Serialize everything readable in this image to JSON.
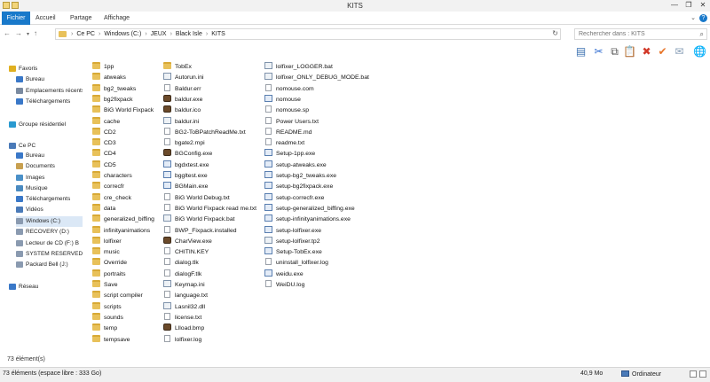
{
  "window": {
    "title": "KITS",
    "minimize": "—",
    "maximize": "❐",
    "close": "✕"
  },
  "ribbon": {
    "tabs": [
      "Fichier",
      "Accueil",
      "Partage",
      "Affichage"
    ],
    "expand": "⌄",
    "help": "?"
  },
  "address": {
    "back": "←",
    "forward": "→",
    "recent": "▾",
    "up": "↑",
    "crumbs": [
      "Ce PC",
      "Windows (C:)",
      "JEUX",
      "Black Isle",
      "KITS"
    ],
    "separator": "›",
    "refresh": "↻"
  },
  "search": {
    "placeholder": "Rechercher dans : KITS",
    "icon": "⌕"
  },
  "toolbar": {
    "icons": [
      "image-list-icon",
      "cut-icon",
      "copy-icon",
      "paste-icon",
      "delete-icon",
      "checkmark-icon",
      "email-icon",
      "web-icon"
    ],
    "glyphs": [
      "▤",
      "✂",
      "⧉",
      "📋",
      "✖",
      "✔",
      "✉",
      "🌐"
    ],
    "colors": [
      "#3a6fb0",
      "#2d6ad0",
      "#555555",
      "#7a6a3a",
      "#d23a2a",
      "#e8762a",
      "#8aa0b8",
      "#3a8fd0"
    ]
  },
  "navpane": {
    "items": [
      {
        "label": "Favoris",
        "icon": "star-icon",
        "color": "#e0b020",
        "indent": 0
      },
      {
        "label": "Bureau",
        "icon": "desktop-icon",
        "color": "#3a78c8",
        "indent": 1
      },
      {
        "label": "Emplacements récents",
        "icon": "recent-places-icon",
        "color": "#7a8aa0",
        "indent": 1
      },
      {
        "label": "Téléchargements",
        "icon": "downloads-icon",
        "color": "#3a78c8",
        "indent": 1
      },
      {
        "label": "Groupe résidentiel",
        "icon": "homegroup-icon",
        "color": "#2a9ad0",
        "indent": 0
      },
      {
        "label": "Ce PC",
        "icon": "computer-icon",
        "color": "#4a7ab8",
        "indent": 0
      },
      {
        "label": "Bureau",
        "icon": "desktop-icon",
        "color": "#3a78c8",
        "indent": 1
      },
      {
        "label": "Documents",
        "icon": "documents-icon",
        "color": "#c8a050",
        "indent": 1
      },
      {
        "label": "Images",
        "icon": "pictures-icon",
        "color": "#4a90c8",
        "indent": 1
      },
      {
        "label": "Musique",
        "icon": "music-icon",
        "color": "#4a8ac0",
        "indent": 1
      },
      {
        "label": "Téléchargements",
        "icon": "downloads-icon",
        "color": "#3a78c8",
        "indent": 1
      },
      {
        "label": "Vidéos",
        "icon": "videos-icon",
        "color": "#4a7ab8",
        "indent": 1
      },
      {
        "label": "Windows (C:)",
        "icon": "drive-icon",
        "color": "#8a9ab0",
        "indent": 1,
        "selected": true
      },
      {
        "label": "RECOVERY (D:)",
        "icon": "drive-icon",
        "color": "#8a9ab0",
        "indent": 1
      },
      {
        "label": "Lecteur de CD (F:) B",
        "icon": "cd-drive-icon",
        "color": "#8a9ab0",
        "indent": 1
      },
      {
        "label": "SYSTEM RESERVED (",
        "icon": "drive-icon",
        "color": "#8a9ab0",
        "indent": 1
      },
      {
        "label": "Packard Bell (J:)",
        "icon": "drive-icon",
        "color": "#8a9ab0",
        "indent": 1
      },
      {
        "label": "Réseau",
        "icon": "network-icon",
        "color": "#3a78c8",
        "indent": 0
      }
    ]
  },
  "files": {
    "columns": [
      [
        {
          "name": "1pp",
          "type": "folder"
        },
        {
          "name": "atweaks",
          "type": "folder"
        },
        {
          "name": "bg2_tweaks",
          "type": "folder"
        },
        {
          "name": "bg2fixpack",
          "type": "folder"
        },
        {
          "name": "BiG World Fixpack",
          "type": "folder"
        },
        {
          "name": "cache",
          "type": "folder"
        },
        {
          "name": "CD2",
          "type": "folder"
        },
        {
          "name": "CD3",
          "type": "folder"
        },
        {
          "name": "CD4",
          "type": "folder"
        },
        {
          "name": "CD5",
          "type": "folder"
        },
        {
          "name": "characters",
          "type": "folder"
        },
        {
          "name": "correcfr",
          "type": "folder"
        },
        {
          "name": "cre_check",
          "type": "folder"
        },
        {
          "name": "data",
          "type": "folder"
        },
        {
          "name": "generalized_biffing",
          "type": "folder"
        },
        {
          "name": "infinityanimations",
          "type": "folder"
        },
        {
          "name": "lolfixer",
          "type": "folder"
        },
        {
          "name": "music",
          "type": "folder"
        },
        {
          "name": "Override",
          "type": "folder"
        },
        {
          "name": "portraits",
          "type": "folder"
        },
        {
          "name": "Save",
          "type": "folder"
        },
        {
          "name": "script compiler",
          "type": "folder"
        },
        {
          "name": "scripts",
          "type": "folder"
        },
        {
          "name": "sounds",
          "type": "folder"
        },
        {
          "name": "temp",
          "type": "folder"
        },
        {
          "name": "tempsave",
          "type": "folder"
        }
      ],
      [
        {
          "name": "TobEx",
          "type": "folder"
        },
        {
          "name": "Autorun.ini",
          "type": "cfg"
        },
        {
          "name": "Baldur.err",
          "type": "doc"
        },
        {
          "name": "baldur.exe",
          "type": "app"
        },
        {
          "name": "baldur.ico",
          "type": "app"
        },
        {
          "name": "baldur.ini",
          "type": "cfg"
        },
        {
          "name": "BG2-ToBPatchReadMe.txt",
          "type": "doc"
        },
        {
          "name": "bgate2.mpi",
          "type": "doc"
        },
        {
          "name": "BGConfig.exe",
          "type": "app"
        },
        {
          "name": "bgdxtest.exe",
          "type": "exe"
        },
        {
          "name": "bggltest.exe",
          "type": "exe"
        },
        {
          "name": "BGMain.exe",
          "type": "exe"
        },
        {
          "name": "BiG World Debug.txt",
          "type": "doc"
        },
        {
          "name": "BiG World Fixpack read me.txt",
          "type": "doc"
        },
        {
          "name": "BiG World Fixpack.bat",
          "type": "cfg"
        },
        {
          "name": "BWP_Fixpack.installed",
          "type": "doc"
        },
        {
          "name": "CharView.exe",
          "type": "app"
        },
        {
          "name": "CHITIN.KEY",
          "type": "doc"
        },
        {
          "name": "dialog.tlk",
          "type": "doc"
        },
        {
          "name": "dialogF.tlk",
          "type": "doc"
        },
        {
          "name": "Keymap.ini",
          "type": "cfg"
        },
        {
          "name": "language.txt",
          "type": "doc"
        },
        {
          "name": "Lasnil32.dll",
          "type": "cfg"
        },
        {
          "name": "license.txt",
          "type": "doc"
        },
        {
          "name": "Llload.bmp",
          "type": "app"
        },
        {
          "name": "lolfixer.log",
          "type": "doc"
        }
      ],
      [
        {
          "name": "lolfixer_LOGGER.bat",
          "type": "cfg"
        },
        {
          "name": "lolfixer_ONLY_DEBUG_MODE.bat",
          "type": "cfg"
        },
        {
          "name": "nomouse.com",
          "type": "doc"
        },
        {
          "name": "nomouse",
          "type": "exe"
        },
        {
          "name": "nomouse.sp",
          "type": "doc"
        },
        {
          "name": "Power Users.txt",
          "type": "doc"
        },
        {
          "name": "README.md",
          "type": "doc"
        },
        {
          "name": "readme.txt",
          "type": "doc"
        },
        {
          "name": "Setup-1pp.exe",
          "type": "exe"
        },
        {
          "name": "setup-atweaks.exe",
          "type": "exe"
        },
        {
          "name": "setup-bg2_tweaks.exe",
          "type": "exe"
        },
        {
          "name": "setup-bg2fixpack.exe",
          "type": "exe"
        },
        {
          "name": "setup-correcfr.exe",
          "type": "exe"
        },
        {
          "name": "setup-generalized_biffing.exe",
          "type": "exe"
        },
        {
          "name": "setup-infinityanimations.exe",
          "type": "exe"
        },
        {
          "name": "setup-lolfixer.exe",
          "type": "exe"
        },
        {
          "name": "setup-lolfixer.tp2",
          "type": "cfg"
        },
        {
          "name": "Setup-TobEx.exe",
          "type": "exe"
        },
        {
          "name": "uninstall_lolfixer.log",
          "type": "doc"
        },
        {
          "name": "weidu.exe",
          "type": "exe"
        },
        {
          "name": "WeiDU.log",
          "type": "doc"
        }
      ]
    ]
  },
  "status": {
    "count": "73 élément(s)",
    "bottom_left": "73 éléments (espace libre : 333 Go)",
    "size": "40,9 Mo",
    "computer": "Ordinateur"
  }
}
